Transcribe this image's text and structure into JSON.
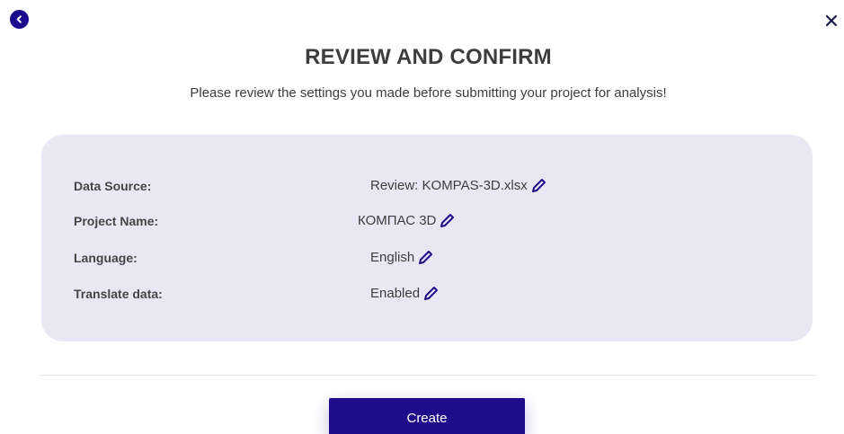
{
  "header": {
    "title": "REVIEW AND CONFIRM",
    "subtitle": "Please review the settings you made before submitting your project for analysis!"
  },
  "summary": {
    "rows": [
      {
        "label": "Data Source:",
        "value": "Review: KOMPAS-3D.xlsx"
      },
      {
        "label": "Project Name:",
        "value": "КОМПАС 3D"
      },
      {
        "label": "Language:",
        "value": "English"
      },
      {
        "label": "Translate data:",
        "value": "Enabled"
      }
    ]
  },
  "actions": {
    "create_label": "Create"
  },
  "icons": {
    "back": "chevron-left-icon",
    "close": "close-icon",
    "edit": "pencil-icon"
  },
  "colors": {
    "accent": "#1f0c8a",
    "card_background": "#e9e7f4"
  }
}
